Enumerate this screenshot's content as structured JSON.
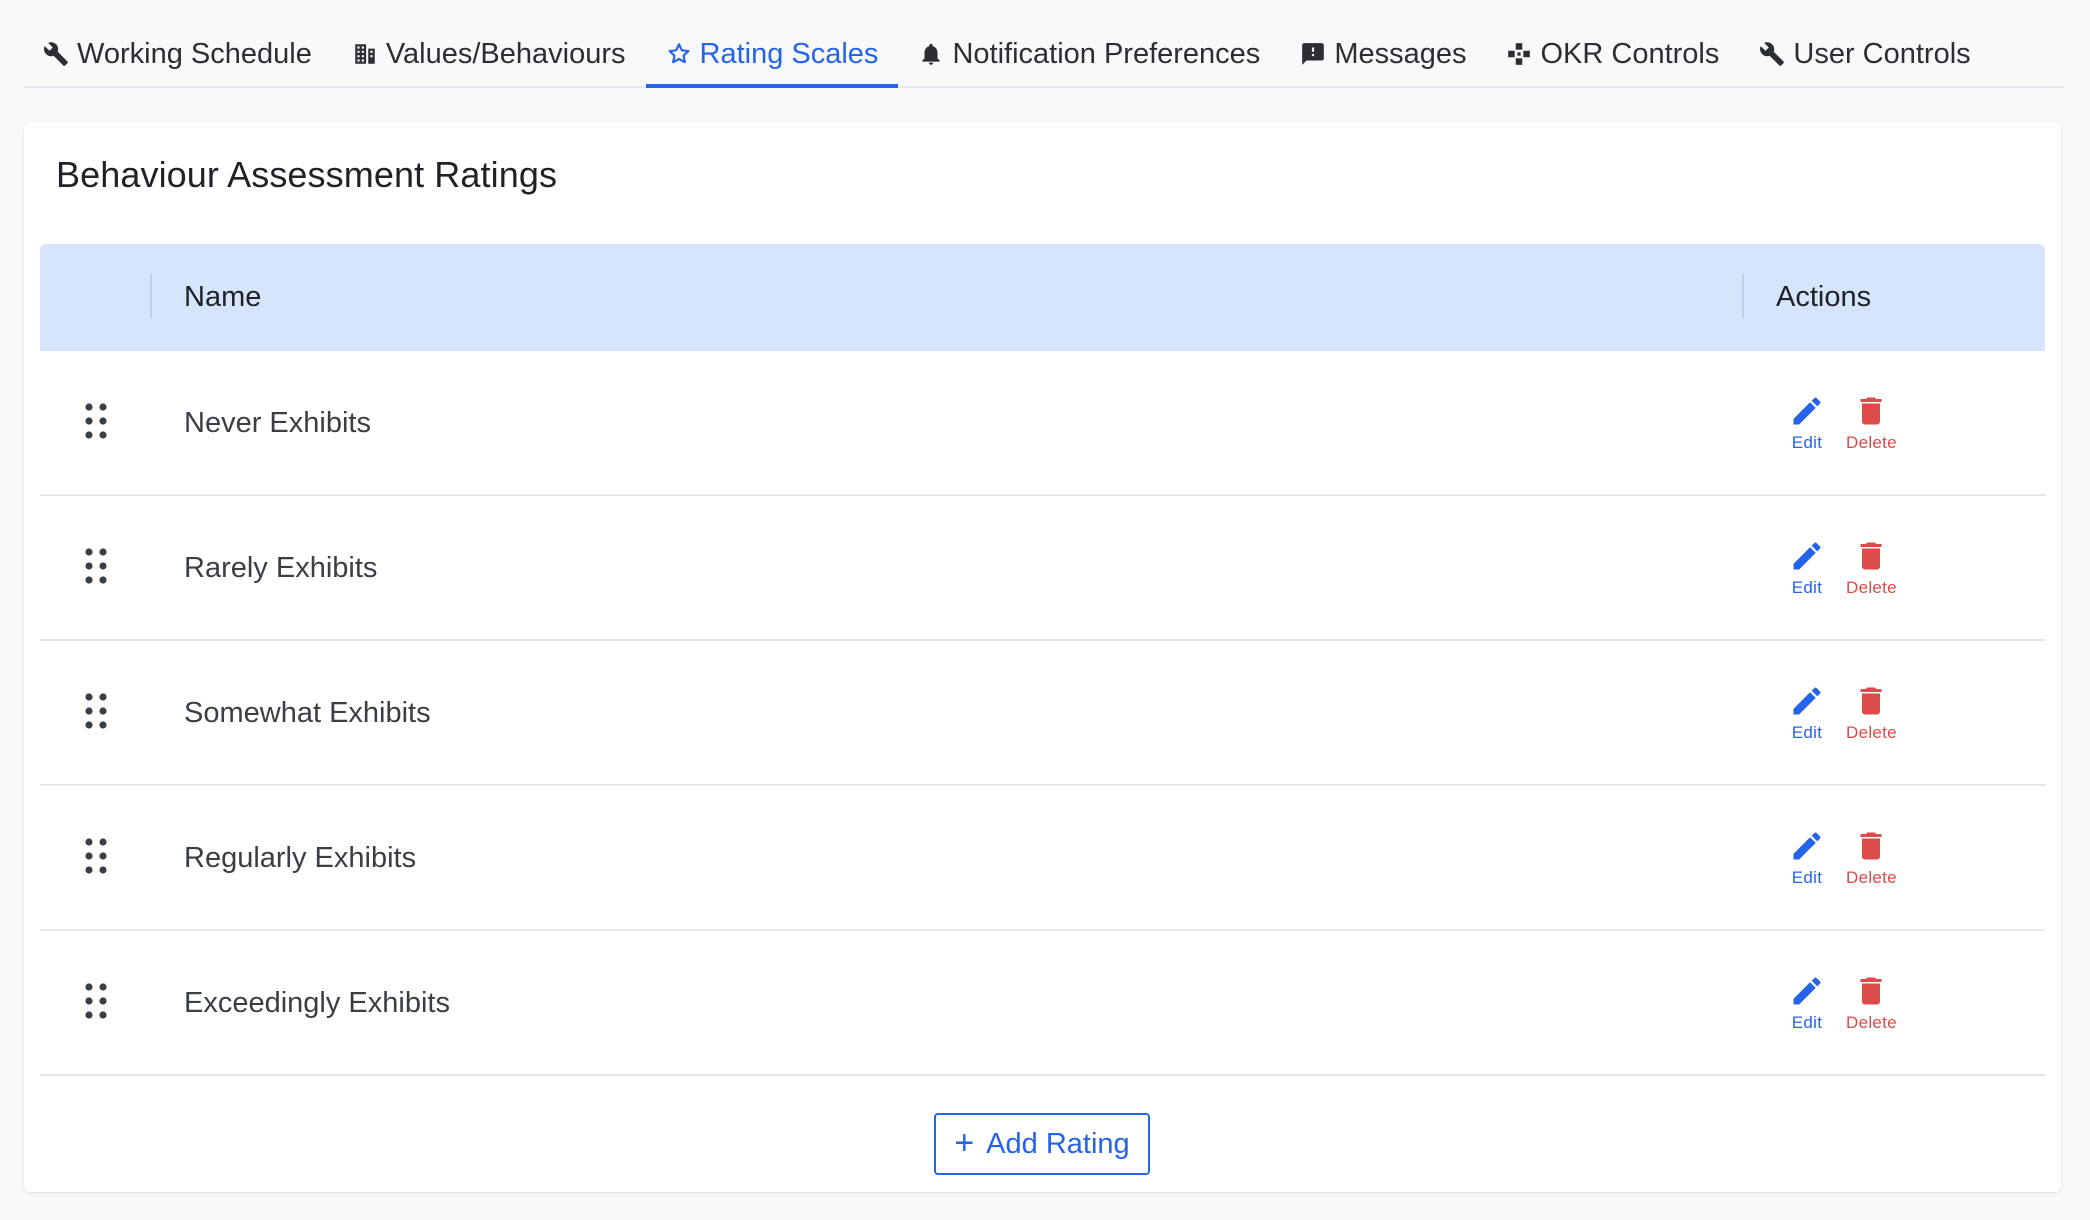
{
  "tabs": [
    {
      "label": "Working Schedule",
      "icon": "wrench-icon",
      "active": false
    },
    {
      "label": "Values/Behaviours",
      "icon": "building-icon",
      "active": false
    },
    {
      "label": "Rating Scales",
      "icon": "star-icon",
      "active": true
    },
    {
      "label": "Notification Preferences",
      "icon": "bell-icon",
      "active": false
    },
    {
      "label": "Messages",
      "icon": "message-icon",
      "active": false
    },
    {
      "label": "OKR Controls",
      "icon": "nodes-icon",
      "active": false
    },
    {
      "label": "User Controls",
      "icon": "wrench-icon",
      "active": false
    }
  ],
  "card": {
    "title": "Behaviour Assessment Ratings"
  },
  "table": {
    "columns": {
      "name": "Name",
      "actions": "Actions"
    },
    "rows": [
      {
        "name": "Never Exhibits"
      },
      {
        "name": "Rarely Exhibits"
      },
      {
        "name": "Somewhat Exhibits"
      },
      {
        "name": "Regularly Exhibits"
      },
      {
        "name": "Exceedingly Exhibits"
      }
    ],
    "edit_label": "Edit",
    "delete_label": "Delete"
  },
  "add_button": {
    "label": "Add Rating"
  },
  "colors": {
    "accent": "#2563eb",
    "danger": "#dc4a4a",
    "header_bg": "#d6e4fc"
  }
}
